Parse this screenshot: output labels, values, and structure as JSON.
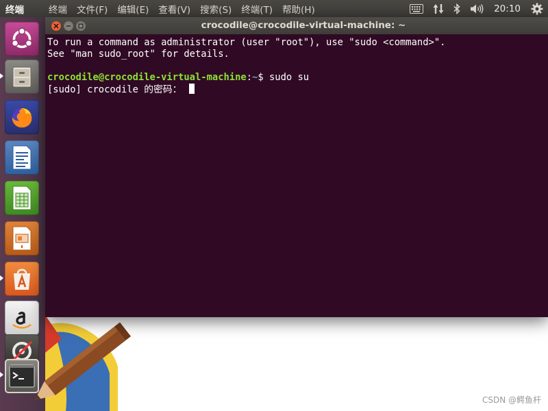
{
  "top_panel": {
    "app_name": "终端",
    "menus": [
      "终端",
      "文件(F)",
      "编辑(E)",
      "查看(V)",
      "搜索(S)",
      "终端(T)",
      "帮助(H)"
    ],
    "indicators": [
      "keyboard-icon",
      "network-icon",
      "bluetooth-icon",
      "volume-icon",
      "gear-icon"
    ],
    "clock": "20:10"
  },
  "launcher": {
    "items": [
      "ubuntu-dash-icon",
      "files-icon",
      "firefox-icon",
      "writer-icon",
      "calc-icon",
      "impress-icon",
      "software-center-icon",
      "amazon-icon",
      "update-icon",
      "terminal-icon"
    ]
  },
  "window": {
    "title": "crocodile@crocodile-virtual-machine: ~"
  },
  "terminal": {
    "line1": "To run a command as administrator (user \"root\"), use \"sudo <command>\".",
    "line2": "See \"man sudo_root\" for details.",
    "prompt_user": "crocodile@crocodile-virtual-machine",
    "prompt_sep": ":",
    "prompt_path": "~",
    "prompt_cmd": "$ sudo su",
    "password_prompt": "[sudo] crocodile 的密码： "
  },
  "watermark": "CSDN @鳄鱼杆",
  "colors": {
    "terminal_bg": "#300a24",
    "prompt_green": "#8ae234",
    "prompt_blue": "#729fcf",
    "close_orange": "#df4a16"
  }
}
